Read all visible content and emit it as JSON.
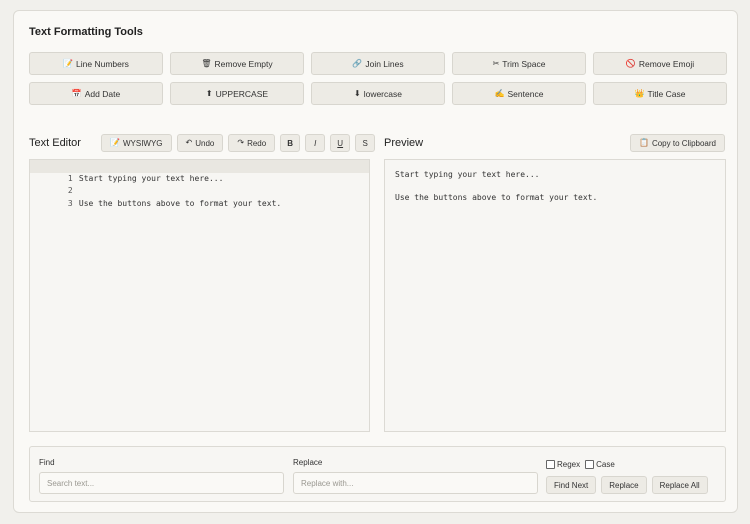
{
  "tools": {
    "title": "Text Formatting Tools",
    "buttons": [
      {
        "icon": "📝",
        "label": "Line Numbers"
      },
      {
        "icon": "🗑",
        "label": "Remove Empty"
      },
      {
        "icon": "🔗",
        "label": "Join Lines"
      },
      {
        "icon": "✂",
        "label": "Trim Space"
      },
      {
        "icon": "🚫",
        "label": "Remove Emoji"
      },
      {
        "icon": "📅",
        "label": "Add Date"
      },
      {
        "icon": "⬆",
        "label": "UPPERCASE"
      },
      {
        "icon": "⬇",
        "label": "lowercase"
      },
      {
        "icon": "✍",
        "label": "Sentence"
      },
      {
        "icon": "👑",
        "label": "Title Case"
      }
    ]
  },
  "editor": {
    "label": "Text Editor",
    "toolbar": {
      "wysiwyg": {
        "icon": "📝",
        "label": "WYSIWYG"
      },
      "undo": {
        "icon": "↶",
        "label": "Undo"
      },
      "redo": {
        "icon": "↷",
        "label": "Redo"
      },
      "bold": "B",
      "italic": "I",
      "underline": "U",
      "strike": "S"
    },
    "lines": [
      {
        "num": "1",
        "text": "Start typing your text here..."
      },
      {
        "num": "2",
        "text": ""
      },
      {
        "num": "3",
        "text": "Use the buttons above to format your text."
      }
    ]
  },
  "preview": {
    "label": "Preview",
    "copy_icon": "📋",
    "copy_label": "Copy to Clipboard",
    "paragraphs": [
      "Start typing your text here...",
      "Use the buttons above to format your text."
    ]
  },
  "find_replace": {
    "find_label": "Find",
    "find_placeholder": "Search text...",
    "replace_label": "Replace",
    "replace_placeholder": "Replace with...",
    "regex_label": "Regex",
    "case_label": "Case",
    "find_next": "Find Next",
    "replace": "Replace",
    "replace_all": "Replace All"
  }
}
